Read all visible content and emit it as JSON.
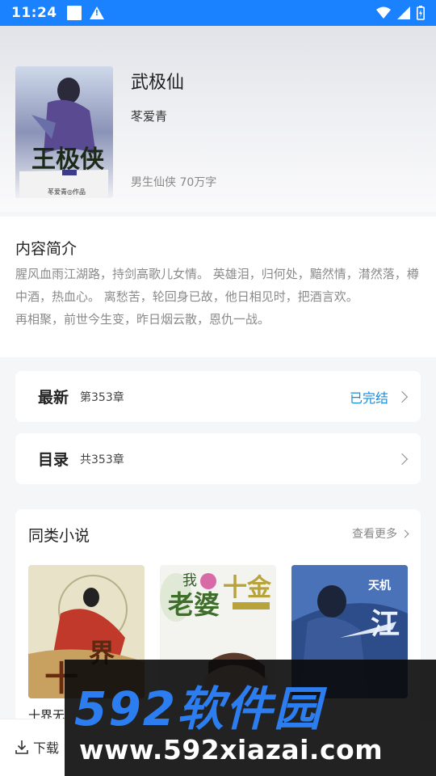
{
  "status_bar": {
    "time": "11:24"
  },
  "book": {
    "title": "武极仙",
    "author": "苳爱青",
    "meta": "男生仙侠 70万字"
  },
  "intro": {
    "heading": "内容简介",
    "paragraphs": [
      "腥风血雨江湖路，持剑高歌儿女情。 英雄泪，归何处，黯然情，潸然落，樽中酒，热血心。 离愁苦，轮回身已故，他日相见时，把酒言欢。",
      "再相聚，前世今生变，昨日烟云散，恩仇一战。"
    ]
  },
  "latest": {
    "label": "最新",
    "value": "第353章",
    "status": "已完结"
  },
  "catalog": {
    "label": "目录",
    "value": "共353章"
  },
  "similar": {
    "heading": "同类小说",
    "more": "查看更多",
    "books": [
      {
        "name": "十界无"
      },
      {
        "name": ""
      },
      {
        "name": ""
      }
    ]
  },
  "bottom": {
    "download": "下载"
  },
  "watermark": {
    "brand": "592软件园",
    "url": "www.592xiazai.com"
  },
  "colors": {
    "status_bar": "#1a82ff",
    "accent": "#1a8cd8"
  }
}
